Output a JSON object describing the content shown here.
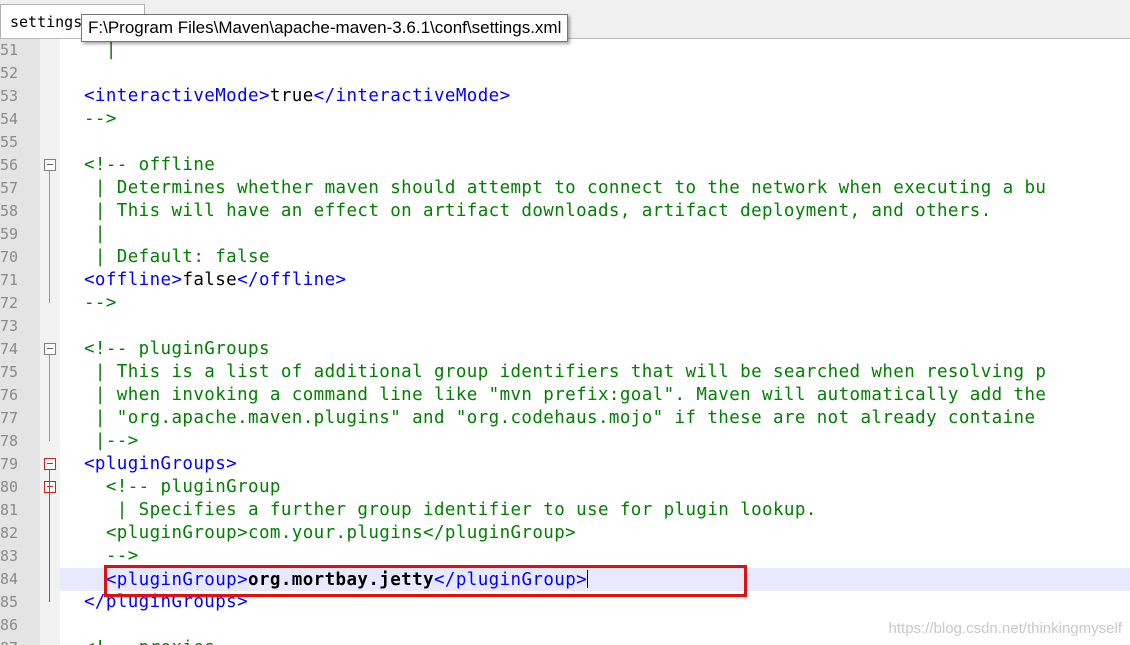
{
  "tab": {
    "label": "settings.xml",
    "close_icon": "close-icon"
  },
  "tooltip": {
    "text": "F:\\Program Files\\Maven\\apache-maven-3.6.1\\conf\\settings.xml"
  },
  "colors": {
    "comment": "#008000",
    "tag": "#0000ff",
    "text": "#000000",
    "highlight_box": "#e01010",
    "active_line": "#e8e8ff"
  },
  "lines": [
    {
      "num": "51",
      "segments": [
        {
          "t": "|",
          "c": "green",
          "indent": "  "
        }
      ]
    },
    {
      "num": "52",
      "segments": []
    },
    {
      "num": "53",
      "segments": [
        {
          "t": "<interactiveMode>",
          "c": "blue"
        },
        {
          "t": "true",
          "c": "black"
        },
        {
          "t": "</interactiveMode>",
          "c": "blue"
        }
      ]
    },
    {
      "num": "54",
      "segments": [
        {
          "t": "-->",
          "c": "green"
        }
      ]
    },
    {
      "num": "55",
      "segments": []
    },
    {
      "num": "56",
      "fold": "box",
      "segments": [
        {
          "t": "<!-- offline",
          "c": "green"
        }
      ]
    },
    {
      "num": "57",
      "segments": [
        {
          "t": " | Determines whether maven should attempt to connect to the network when executing a bu",
          "c": "green"
        }
      ]
    },
    {
      "num": "58",
      "segments": [
        {
          "t": " | This will have an effect on artifact downloads, artifact deployment, and others.",
          "c": "green"
        }
      ]
    },
    {
      "num": "59",
      "segments": [
        {
          "t": " |",
          "c": "green"
        }
      ]
    },
    {
      "num": "70",
      "segments": [
        {
          "t": " | Default: false",
          "c": "green"
        }
      ]
    },
    {
      "num": "71",
      "segments": [
        {
          "t": "<offline>",
          "c": "blue"
        },
        {
          "t": "false",
          "c": "black"
        },
        {
          "t": "</offline>",
          "c": "blue"
        }
      ]
    },
    {
      "num": "72",
      "segments": [
        {
          "t": "-->",
          "c": "green"
        }
      ]
    },
    {
      "num": "73",
      "segments": []
    },
    {
      "num": "74",
      "fold": "box",
      "segments": [
        {
          "t": "<!-- pluginGroups",
          "c": "green"
        }
      ]
    },
    {
      "num": "75",
      "segments": [
        {
          "t": " | This is a list of additional group identifiers that will be searched when resolving p",
          "c": "green"
        }
      ]
    },
    {
      "num": "76",
      "segments": [
        {
          "t": " | when invoking a command line like \"mvn prefix:goal\". Maven will automatically add the",
          "c": "green"
        }
      ]
    },
    {
      "num": "77",
      "segments": [
        {
          "t": " | \"org.apache.maven.plugins\" and \"org.codehaus.mojo\" if these are not already containe",
          "c": "green"
        }
      ]
    },
    {
      "num": "78",
      "segments": [
        {
          "t": " |-->",
          "c": "green"
        }
      ]
    },
    {
      "num": "79",
      "fold": "red",
      "segments": [
        {
          "t": "<pluginGroups>",
          "c": "blue"
        }
      ]
    },
    {
      "num": "80",
      "fold": "red",
      "segments": [
        {
          "t": "  <!-- pluginGroup",
          "c": "green"
        }
      ]
    },
    {
      "num": "81",
      "segments": [
        {
          "t": "   | Specifies a further group identifier to use for plugin lookup.",
          "c": "green"
        }
      ]
    },
    {
      "num": "82",
      "segments": [
        {
          "t": "  <pluginGroup>com.your.plugins</pluginGroup>",
          "c": "green"
        }
      ]
    },
    {
      "num": "83",
      "segments": [
        {
          "t": "  -->",
          "c": "green"
        }
      ]
    },
    {
      "num": "84",
      "active": true,
      "segments": [
        {
          "t": "  <pluginGroup>",
          "c": "blue"
        },
        {
          "t": "org.mortbay.jetty",
          "c": "bold"
        },
        {
          "t": "</pluginGroup>",
          "c": "blue"
        }
      ]
    },
    {
      "num": "85",
      "segments": [
        {
          "t": "</pluginGroups>",
          "c": "blue"
        }
      ]
    },
    {
      "num": "86",
      "segments": []
    },
    {
      "num": "87",
      "segments": [
        {
          "t": "<!-- proxies",
          "c": "green"
        }
      ]
    }
  ],
  "watermark": "https://blog.csdn.net/thinkingmyself"
}
